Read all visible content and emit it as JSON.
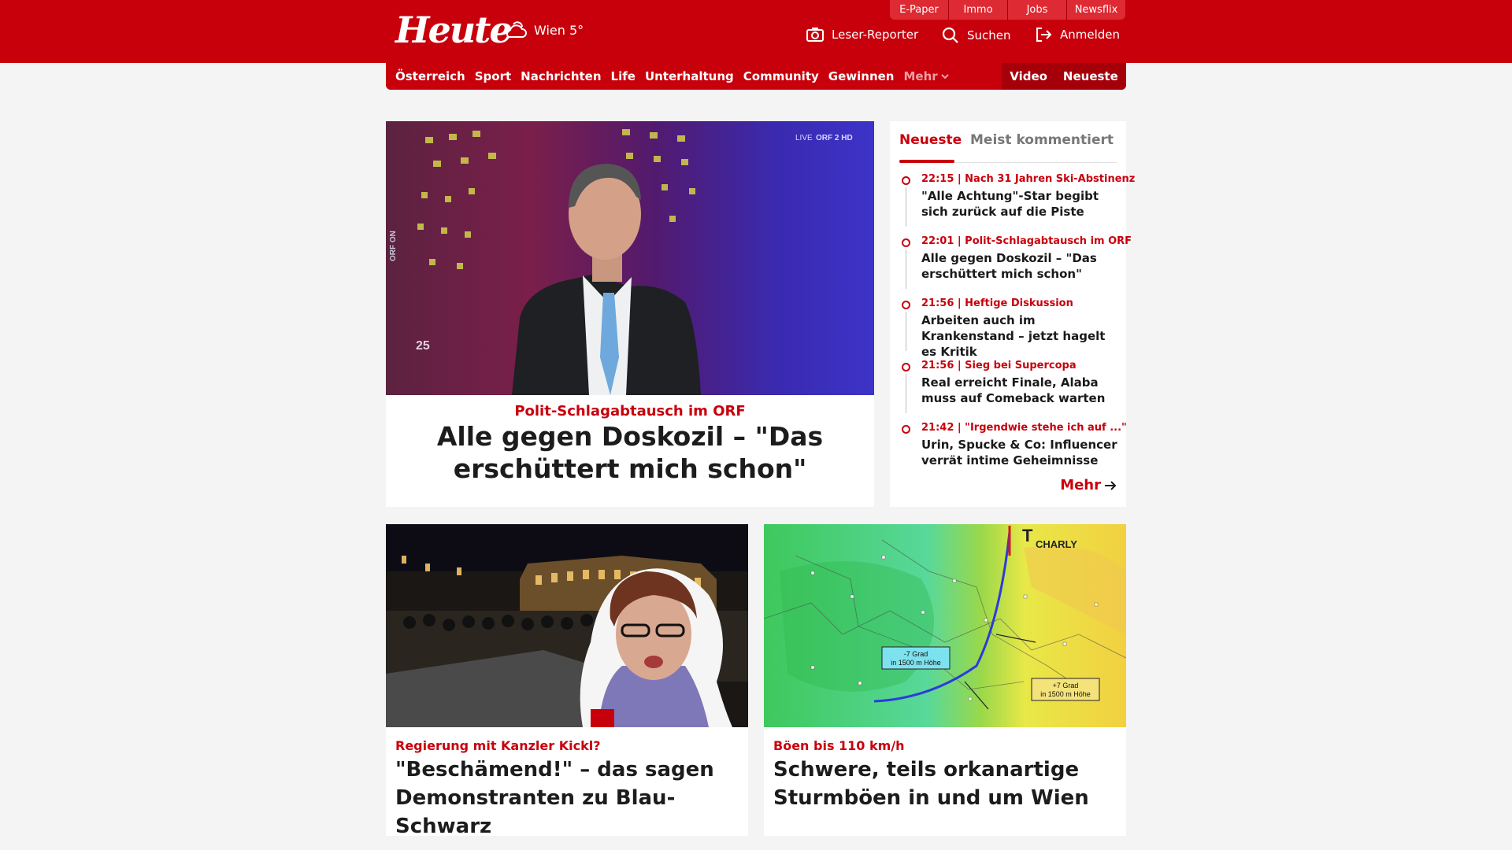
{
  "header": {
    "logo": "Heute",
    "weather": {
      "icon": "cloud-sun-icon",
      "text": "Wien 5°"
    },
    "top_links": [
      "E-Paper",
      "Immo",
      "Jobs",
      "Newsflix"
    ],
    "actions": {
      "reporter": "Leser-Reporter",
      "search": "Suchen",
      "login": "Anmelden"
    }
  },
  "nav": {
    "items": [
      "Österreich",
      "Sport",
      "Nachrichten",
      "Life",
      "Unterhaltung",
      "Community",
      "Gewinnen"
    ],
    "more": "Mehr",
    "right": [
      "Video",
      "Neueste"
    ]
  },
  "hero": {
    "badge": "LIVE",
    "channel": "ORF 2 HD",
    "side_label": "ORF ON",
    "counter": "25",
    "kicker": "Polit-Schlagabtausch im ORF",
    "title": "Alle gegen Doskozil – \"Das erschüttert mich schon\""
  },
  "sidebar": {
    "tabs": [
      "Neueste",
      "Meist kommentiert"
    ],
    "items": [
      {
        "meta": "22:15 | Nach 31 Jahren Ski-Abstinenz",
        "title": "\"Alle Achtung\"-Star begibt sich zurück auf die Piste"
      },
      {
        "meta": "22:01 | Polit-Schlagabtausch im ORF",
        "title": "Alle gegen Doskozil – \"Das erschüttert mich schon\""
      },
      {
        "meta": "21:56 | Heftige Diskussion",
        "title": "Arbeiten auch im Krankenstand – jetzt hagelt es Kritik"
      },
      {
        "meta": "21:56 | Sieg bei Supercopa",
        "title": "Real erreicht Finale, Alaba muss auf Comeback warten"
      },
      {
        "meta": "21:42 | \"Irgendwie stehe ich auf ...\"",
        "title": "Urin, Spucke & Co: Influencer verrät intime Geheimnisse"
      }
    ],
    "more": "Mehr"
  },
  "cards": [
    {
      "kicker": "Regierung mit Kanzler Kickl?",
      "title": "\"Beschämend!\" – das sagen Demonstranten zu Blau-Schwarz"
    },
    {
      "kicker": "Böen bis 110 km/h",
      "title": "Schwere, teils orkanartige Sturmböen in und um Wien",
      "map": {
        "front": "T",
        "front_name": "CHARLY",
        "label_cold": [
          "-7 Grad",
          "in 1500 m Höhe"
        ],
        "label_warm": [
          "+7 Grad",
          "in 1500 m Höhe"
        ]
      }
    }
  ],
  "colors": {
    "brand": "#c8000c",
    "brand_dark": "#a5000a",
    "background": "#f4f4f4"
  }
}
